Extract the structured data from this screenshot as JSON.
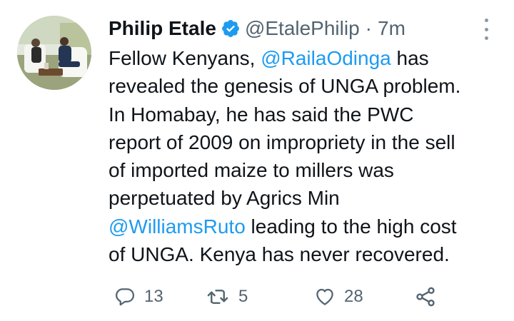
{
  "author": {
    "name": "Philip Etale",
    "handle": "@EtalePhilip",
    "separator": "·",
    "time": "7m",
    "verified": true
  },
  "tweet": {
    "lines": [
      [
        {
          "t": "Fellow Kenyans, ",
          "m": false
        },
        {
          "t": "@RailaOdinga",
          "m": true
        },
        {
          "t": " has",
          "m": false
        }
      ],
      [
        {
          "t": "revealed the genesis of UNGA problem.",
          "m": false
        }
      ],
      [
        {
          "t": "In Homabay, he has said the PWC",
          "m": false
        }
      ],
      [
        {
          "t": "report of 2009 on impropriety in the sell",
          "m": false
        }
      ],
      [
        {
          "t": "of imported maize to millers was",
          "m": false
        }
      ],
      [
        {
          "t": "perpetuated by Agrics Min",
          "m": false
        }
      ],
      [
        {
          "t": "@WilliamsRuto",
          "m": true
        },
        {
          "t": " leading to the high cost",
          "m": false
        }
      ],
      [
        {
          "t": "of UNGA. Kenya has never recovered.",
          "m": false
        }
      ]
    ]
  },
  "actions": {
    "replies": "13",
    "retweets": "5",
    "likes": "28"
  },
  "colors": {
    "mention": "#1d9bf0",
    "secondary_text": "#536471",
    "verified_badge": "#1d9bf0"
  },
  "icons": {
    "reply": "reply-icon",
    "retweet": "retweet-icon",
    "like": "heart-icon",
    "share": "share-icon",
    "more": "more-options-icon",
    "verified": "verified-badge-icon"
  }
}
